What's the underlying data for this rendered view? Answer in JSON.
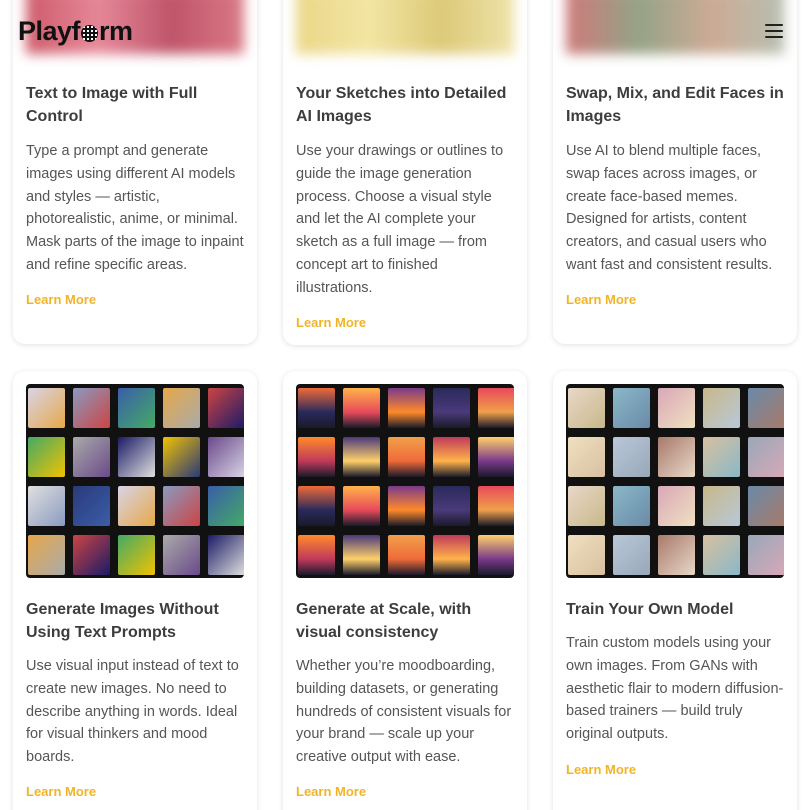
{
  "header": {
    "logo_prefix": "Playf",
    "logo_suffix": "rm"
  },
  "cards": [
    {
      "title": "Text to Image with Full Control",
      "desc": "Type a prompt and generate images using different AI models and styles — artistic, photorealistic, anime, or minimal. Mask parts of the image to inpaint and refine specific areas.",
      "link": "Learn More"
    },
    {
      "title": "Your Sketches into Detailed AI Images",
      "desc": "Use your drawings or outlines to guide the image generation process. Choose a visual style and let the AI complete your sketch as a full image — from concept art to finished illustrations.",
      "link": "Learn More"
    },
    {
      "title": "Swap, Mix, and Edit Faces in Images",
      "desc": "Use AI to blend multiple faces, swap faces across images, or create face-based memes. Designed for artists, content creators, and casual users who want fast and consistent results.",
      "link": "Learn More"
    },
    {
      "title": "Generate Images Without Using Text Prompts",
      "desc": "Use visual input instead of text to create new images. No need to describe anything in words. Ideal for visual thinkers and mood boards.",
      "link": "Learn More"
    },
    {
      "title": "Generate at Scale, with visual consistency",
      "desc": "Whether you’re moodboarding, building datasets, or generating hundreds of consistent visuals for your brand — scale up your creative output with ease.",
      "link": "Learn More"
    },
    {
      "title": "Train Your Own Model",
      "desc": "Train custom models using your own images. From GANs with aesthetic flair to modern diffusion-based trainers — build truly original outputs.",
      "link": "Learn More"
    }
  ],
  "colors": {
    "accent": "#f0b429",
    "title": "#3d3d3d",
    "text": "#555555"
  },
  "icons": {
    "menu": "hamburger-menu-icon"
  }
}
